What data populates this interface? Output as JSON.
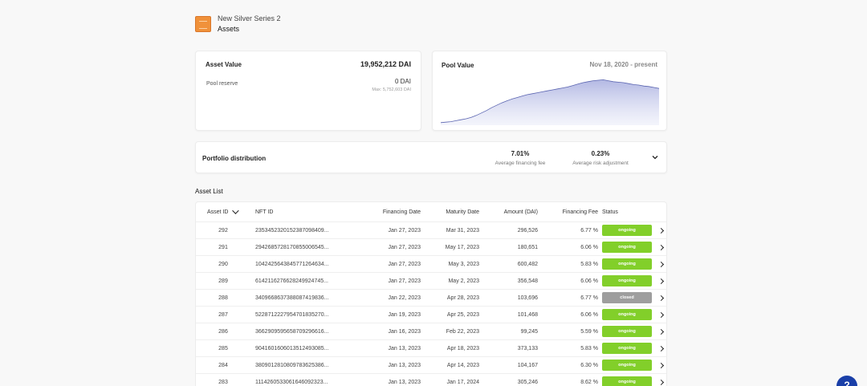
{
  "header": {
    "pool_name": "New Silver Series 2",
    "section": "Assets"
  },
  "asset_value": {
    "title": "Asset Value",
    "total": "19,952,212 DAI",
    "reserve_label": "Pool reserve",
    "reserve_value": "0 DAI",
    "reserve_max": "Max: 5,752,603 DAI"
  },
  "pool_value": {
    "title": "Pool Value",
    "date_range": "Nov 18, 2020 - present",
    "chart_data": {
      "type": "area",
      "series": [
        {
          "values": [
            2,
            3,
            4,
            6,
            8,
            10,
            13,
            17,
            22,
            27,
            33,
            38,
            43,
            47,
            51,
            54,
            57,
            60,
            62,
            64,
            66,
            68,
            70,
            72,
            74,
            76,
            79,
            82,
            85,
            87,
            89,
            90,
            91,
            89,
            87,
            86,
            85,
            83,
            81,
            80,
            78,
            77,
            75,
            73
          ]
        }
      ]
    }
  },
  "portfolio": {
    "title": "Portfolio distribution",
    "financing_fee_value": "7.01%",
    "financing_fee_label": "Average financing fee",
    "risk_value": "0.23%",
    "risk_label": "Average risk adjustment"
  },
  "asset_list": {
    "title": "Asset List",
    "headers": {
      "id": "Asset ID",
      "nft": "NFT ID",
      "financing_date": "Financing Date",
      "maturity_date": "Maturity Date",
      "amount": "Amount (DAI)",
      "fee": "Financing Fee",
      "status": "Status"
    },
    "rows": [
      {
        "id": "292",
        "nft": "2353452320152387098409...",
        "financing_date": "Jan 27, 2023",
        "maturity_date": "Mar 31, 2023",
        "amount": "296,526",
        "fee": "6.77 %",
        "status": "ongoing"
      },
      {
        "id": "291",
        "nft": "2942685728170855006545...",
        "financing_date": "Jan 27, 2023",
        "maturity_date": "May 17, 2023",
        "amount": "180,651",
        "fee": "6.06 %",
        "status": "ongoing"
      },
      {
        "id": "290",
        "nft": "1042425643845771264634...",
        "financing_date": "Jan 27, 2023",
        "maturity_date": "May 3, 2023",
        "amount": "600,482",
        "fee": "5.83 %",
        "status": "ongoing"
      },
      {
        "id": "289",
        "nft": "6142116276628249924745...",
        "financing_date": "Jan 27, 2023",
        "maturity_date": "May 2, 2023",
        "amount": "356,548",
        "fee": "6.06 %",
        "status": "ongoing"
      },
      {
        "id": "288",
        "nft": "3409668637388087419836...",
        "financing_date": "Jan 22, 2023",
        "maturity_date": "Apr 28, 2023",
        "amount": "103,696",
        "fee": "6.77 %",
        "status": "closed"
      },
      {
        "id": "287",
        "nft": "5228712227954701835270...",
        "financing_date": "Jan 19, 2023",
        "maturity_date": "Apr 25, 2023",
        "amount": "101,468",
        "fee": "6.06 %",
        "status": "ongoing"
      },
      {
        "id": "286",
        "nft": "3662909595658709296616...",
        "financing_date": "Jan 16, 2023",
        "maturity_date": "Feb 22, 2023",
        "amount": "99,245",
        "fee": "5.59 %",
        "status": "ongoing"
      },
      {
        "id": "285",
        "nft": "9041601606013512493085...",
        "financing_date": "Jan 13, 2023",
        "maturity_date": "Apr 18, 2023",
        "amount": "373,133",
        "fee": "5.83 %",
        "status": "ongoing"
      },
      {
        "id": "284",
        "nft": "3809012810809783625386...",
        "financing_date": "Jan 13, 2023",
        "maturity_date": "Apr 14, 2023",
        "amount": "104,167",
        "fee": "6.30 %",
        "status": "ongoing"
      },
      {
        "id": "283",
        "nft": "1114260533061646092323...",
        "financing_date": "Jan 13, 2023",
        "maturity_date": "Jan 17, 2024",
        "amount": "305,246",
        "fee": "8.62 %",
        "status": "ongoing"
      }
    ]
  },
  "help": {
    "label": "?"
  },
  "colors": {
    "ongoing": "#82cf2a",
    "closed": "#9e9e9e",
    "accent": "#1a3fa8",
    "chart_line": "#3b4aa0"
  }
}
